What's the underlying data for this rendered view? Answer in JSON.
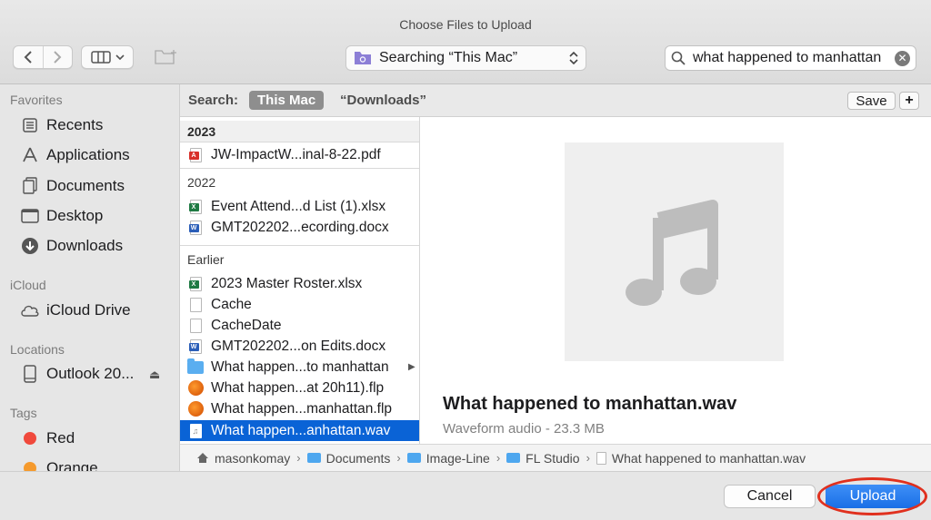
{
  "window": {
    "title": "Choose Files to Upload"
  },
  "toolbar": {
    "location_label": "Searching “This Mac”",
    "search_value": "what happened to manhattan",
    "icons": [
      "chevron-left-icon",
      "chevron-right-icon",
      "column-view-icon",
      "new-folder-icon",
      "search-icon",
      "clear-icon"
    ]
  },
  "sidebar": {
    "favorites_heading": "Favorites",
    "favorites": [
      "Recents",
      "Applications",
      "Documents",
      "Desktop",
      "Downloads"
    ],
    "icloud_heading": "iCloud",
    "icloud": [
      "iCloud Drive"
    ],
    "locations_heading": "Locations",
    "locations": [
      "Outlook 20..."
    ],
    "tags_heading": "Tags",
    "tags": [
      {
        "label": "Red",
        "color": "#f0493c"
      },
      {
        "label": "Orange",
        "color": "#f59a2d"
      }
    ]
  },
  "scope": {
    "label": "Search:",
    "active": "This Mac",
    "option": "“Downloads”",
    "save_label": "Save",
    "add_label": "+"
  },
  "files": {
    "groups": [
      {
        "label": "2023",
        "items": [
          {
            "name": "JW-ImpactW...inal-8-22.pdf",
            "icon": "pdf-file-icon"
          }
        ]
      },
      {
        "label": "2022",
        "items": [
          {
            "name": "Event Attend...d List (1).xlsx",
            "icon": "excel-file-icon"
          },
          {
            "name": "GMT202202...ecording.docx",
            "icon": "word-file-icon"
          }
        ]
      },
      {
        "label": "Earlier",
        "items": [
          {
            "name": "2023 Master Roster.xlsx",
            "icon": "excel-file-icon"
          },
          {
            "name": "Cache",
            "icon": "blank-file-icon"
          },
          {
            "name": "CacheDate",
            "icon": "blank-file-icon"
          },
          {
            "name": "GMT202202...on Edits.docx",
            "icon": "word-file-icon"
          },
          {
            "name": "What happen...to manhattan",
            "icon": "folder-icon"
          },
          {
            "name": "What happen...at 20h11).flp",
            "icon": "fl-studio-file-icon"
          },
          {
            "name": "What happen...manhattan.flp",
            "icon": "fl-studio-file-icon"
          },
          {
            "name": "What happen...anhattan.wav",
            "icon": "audio-file-icon",
            "selected": true
          }
        ]
      }
    ]
  },
  "preview": {
    "name": "What happened to manhattan.wav",
    "meta": "Waveform audio - 23.3 MB",
    "icon": "music-note-icon"
  },
  "path": {
    "crumbs": [
      "masonkomay",
      "Documents",
      "Image-Line",
      "FL Studio",
      "What happened to manhattan.wav"
    ]
  },
  "footer": {
    "cancel_label": "Cancel",
    "upload_label": "Upload",
    "accent": "#1a6fe6",
    "highlight_color": "#e0301e"
  }
}
